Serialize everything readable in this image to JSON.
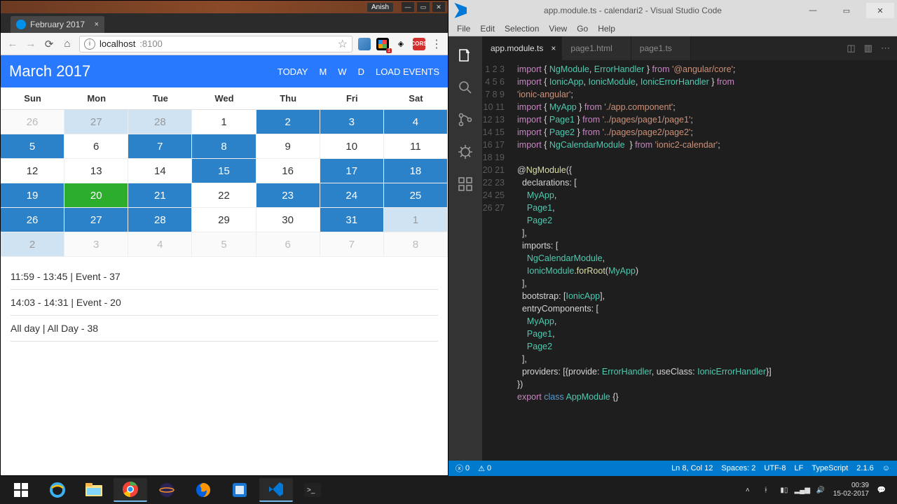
{
  "browser": {
    "os_user": "Anish",
    "tab_title": "February 2017",
    "url_host": "localhost",
    "url_port": ":8100",
    "ext_badge": "1",
    "cors_label": "CORS"
  },
  "calendar": {
    "title": "March 2017",
    "buttons": {
      "today": "TODAY",
      "m": "M",
      "w": "W",
      "d": "D",
      "load": "LOAD EVENTS"
    },
    "dow": [
      "Sun",
      "Mon",
      "Tue",
      "Wed",
      "Thu",
      "Fri",
      "Sat"
    ],
    "cells": [
      {
        "n": "26",
        "c": "oth"
      },
      {
        "n": "27",
        "c": "oth-ev"
      },
      {
        "n": "28",
        "c": "oth-ev"
      },
      {
        "n": "1",
        "c": ""
      },
      {
        "n": "2",
        "c": "ev"
      },
      {
        "n": "3",
        "c": "ev"
      },
      {
        "n": "4",
        "c": "ev"
      },
      {
        "n": "5",
        "c": "ev"
      },
      {
        "n": "6",
        "c": ""
      },
      {
        "n": "7",
        "c": "ev"
      },
      {
        "n": "8",
        "c": "ev"
      },
      {
        "n": "9",
        "c": ""
      },
      {
        "n": "10",
        "c": ""
      },
      {
        "n": "11",
        "c": ""
      },
      {
        "n": "12",
        "c": ""
      },
      {
        "n": "13",
        "c": ""
      },
      {
        "n": "14",
        "c": ""
      },
      {
        "n": "15",
        "c": "ev"
      },
      {
        "n": "16",
        "c": ""
      },
      {
        "n": "17",
        "c": "ev"
      },
      {
        "n": "18",
        "c": "ev"
      },
      {
        "n": "19",
        "c": "ev"
      },
      {
        "n": "20",
        "c": "today"
      },
      {
        "n": "21",
        "c": "ev"
      },
      {
        "n": "22",
        "c": ""
      },
      {
        "n": "23",
        "c": "ev"
      },
      {
        "n": "24",
        "c": "ev"
      },
      {
        "n": "25",
        "c": "ev"
      },
      {
        "n": "26",
        "c": "ev"
      },
      {
        "n": "27",
        "c": "ev"
      },
      {
        "n": "28",
        "c": "ev"
      },
      {
        "n": "29",
        "c": ""
      },
      {
        "n": "30",
        "c": ""
      },
      {
        "n": "31",
        "c": "ev"
      },
      {
        "n": "1",
        "c": "oth-ev"
      },
      {
        "n": "2",
        "c": "oth-ev"
      },
      {
        "n": "3",
        "c": "oth"
      },
      {
        "n": "4",
        "c": "oth"
      },
      {
        "n": "5",
        "c": "oth"
      },
      {
        "n": "6",
        "c": "oth"
      },
      {
        "n": "7",
        "c": "oth"
      },
      {
        "n": "8",
        "c": "oth"
      }
    ],
    "events": [
      "11:59 - 13:45 | Event - 37",
      "14:03 - 14:31 | Event - 20",
      "All day | All Day - 38"
    ]
  },
  "vsc": {
    "title": "app.module.ts - calendari2 - Visual Studio Code",
    "menu": [
      "File",
      "Edit",
      "Selection",
      "View",
      "Go",
      "Help"
    ],
    "tabs": [
      {
        "label": "app.module.ts",
        "active": true,
        "close": true
      },
      {
        "label": "page1.html",
        "active": false,
        "close": false
      },
      {
        "label": "page1.ts",
        "active": false,
        "close": false
      }
    ],
    "max_line": 27,
    "status": {
      "errors": "0",
      "warnings": "0",
      "pos": "Ln 8, Col 12",
      "spaces": "Spaces: 2",
      "enc": "UTF-8",
      "eol": "LF",
      "lang": "TypeScript",
      "ver": "2.1.6"
    }
  },
  "tray": {
    "time": "00:39",
    "date": "15-02-2017"
  }
}
